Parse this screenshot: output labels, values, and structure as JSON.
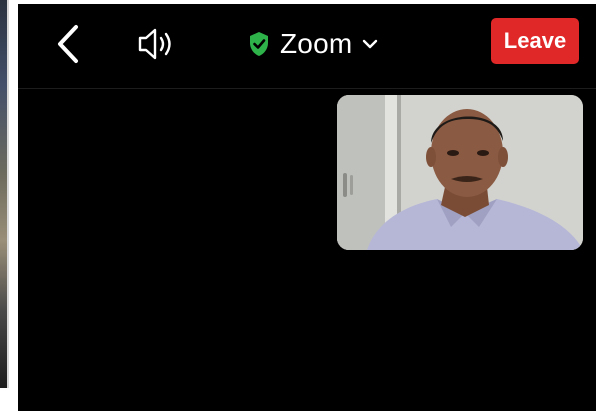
{
  "header": {
    "title": "Zoom",
    "leave_label": "Leave"
  },
  "icons": {
    "back": "chevron-left-icon",
    "speaker": "speaker-icon",
    "secure": "shield-check-icon",
    "title_dropdown": "chevron-down-icon"
  },
  "colors": {
    "background": "#000000",
    "leave_button": "#e02828",
    "secure_shield": "#2eb24a",
    "text": "#ffffff"
  },
  "video_tile": {
    "participant": "participant-video"
  }
}
